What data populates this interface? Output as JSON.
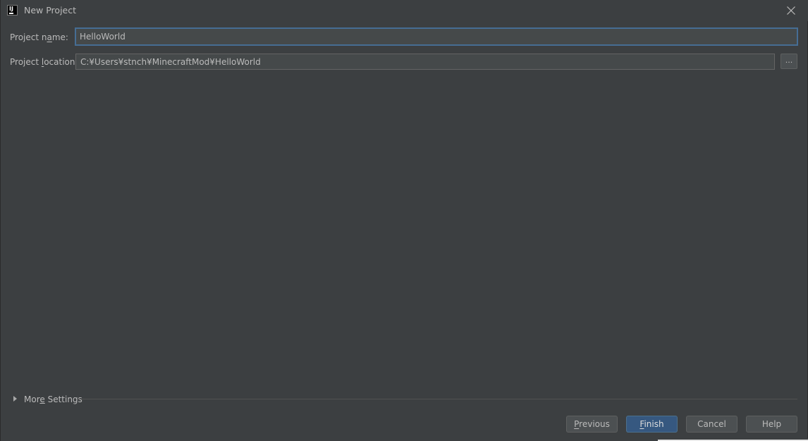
{
  "window": {
    "title": "New Project",
    "app_icon_glyph": "IJ"
  },
  "form": {
    "project_name": {
      "label_pre": "Project n",
      "label_mnemonic": "a",
      "label_post": "me:",
      "value": "HelloWorld"
    },
    "project_location": {
      "label_pre": "Project ",
      "label_mnemonic": "l",
      "label_post": "ocation:",
      "value": "C:¥Users¥stnch¥MinecraftMod¥HelloWorld"
    },
    "browse_label": "..."
  },
  "more_settings": {
    "label_pre": "Mor",
    "label_mnemonic": "e",
    "label_post": " Settings"
  },
  "buttons": {
    "previous": {
      "mnemonic": "P",
      "rest": "revious"
    },
    "finish": {
      "mnemonic": "F",
      "rest": "inish"
    },
    "cancel": {
      "label": "Cancel"
    },
    "help": {
      "label": "Help"
    }
  },
  "colors": {
    "background": "#3c3f41",
    "field_background": "#45494a",
    "focus_border": "#466d94",
    "default_button": "#365880"
  }
}
